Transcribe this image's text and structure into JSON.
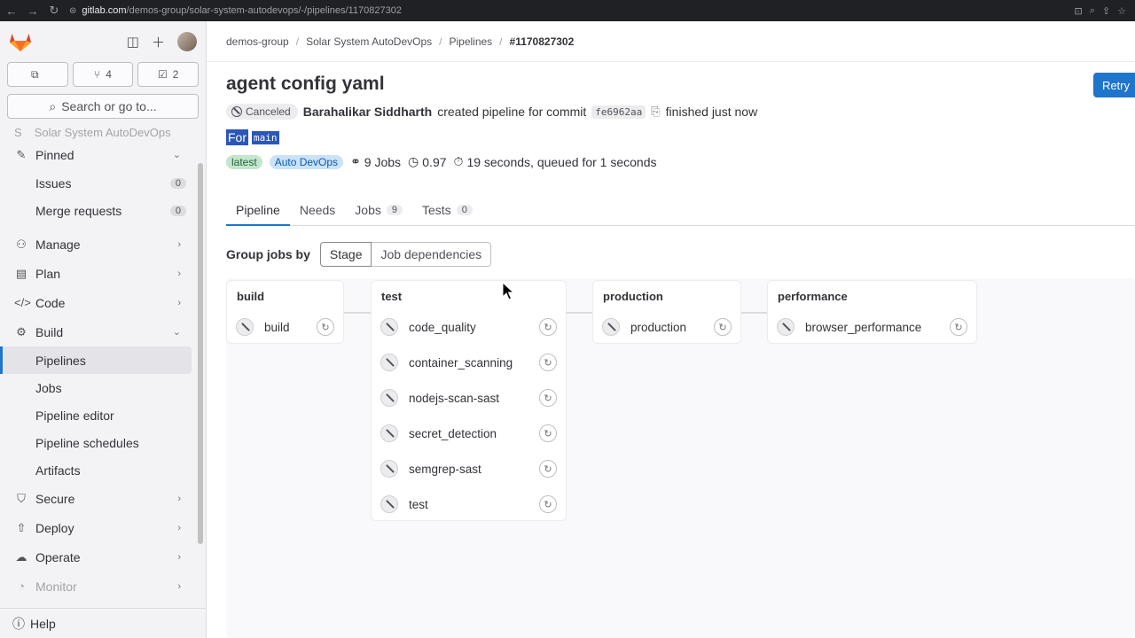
{
  "browser": {
    "url_domain": "gitlab.com",
    "url_path": "/demos-group/solar-system-autodevops/-/pipelines/1170827302"
  },
  "sidebar": {
    "counters": [
      {
        "icon": "issues-icon",
        "count": ""
      },
      {
        "icon": "merge-request-icon",
        "count": "4"
      },
      {
        "icon": "todo-icon",
        "count": "2"
      }
    ],
    "search_label": "Search or go to...",
    "faded_project": "Solar System AutoDevOps",
    "pinned_label": "Pinned",
    "pinned_items": [
      {
        "label": "Issues",
        "badge": "0"
      },
      {
        "label": "Merge requests",
        "badge": "0"
      }
    ],
    "sections": [
      {
        "label": "Manage",
        "icon": "manage-icon"
      },
      {
        "label": "Plan",
        "icon": "plan-icon"
      },
      {
        "label": "Code",
        "icon": "code-icon"
      },
      {
        "label": "Build",
        "icon": "build-icon"
      }
    ],
    "build_items": [
      "Pipelines",
      "Jobs",
      "Pipeline editor",
      "Pipeline schedules",
      "Artifacts"
    ],
    "more_sections": [
      "Secure",
      "Deploy",
      "Operate",
      "Monitor"
    ],
    "help_label": "Help"
  },
  "breadcrumb": [
    "demos-group",
    "Solar System AutoDevOps",
    "Pipelines",
    "#1170827302"
  ],
  "pipeline": {
    "title": "agent config yaml",
    "retry_label": "Retry",
    "status": "Canceled",
    "author": "Barahalikar Siddharth",
    "created_text": "created pipeline for commit",
    "commit_sha": "fe6962aa",
    "finished_text": "finished just now",
    "for_label": "For",
    "branch": "main",
    "tags": [
      "latest",
      "Auto DevOps"
    ],
    "jobs_text": "9 Jobs",
    "score_text": "0.97",
    "duration_text": "19 seconds, queued for 1 seconds"
  },
  "tabs": [
    {
      "label": "Pipeline",
      "count": ""
    },
    {
      "label": "Needs",
      "count": ""
    },
    {
      "label": "Jobs",
      "count": "9"
    },
    {
      "label": "Tests",
      "count": "0"
    }
  ],
  "group_by": {
    "label": "Group jobs by",
    "options": [
      "Stage",
      "Job dependencies"
    ]
  },
  "stages": [
    {
      "name": "build",
      "jobs": [
        "build"
      ]
    },
    {
      "name": "test",
      "jobs": [
        "code_quality",
        "container_scanning",
        "nodejs-scan-sast",
        "secret_detection",
        "semgrep-sast",
        "test"
      ]
    },
    {
      "name": "production",
      "jobs": [
        "production"
      ]
    },
    {
      "name": "performance",
      "jobs": [
        "browser_performance"
      ]
    }
  ],
  "colors": {
    "accent": "#1f75cb",
    "sidebar_bg": "#f3f3f6"
  }
}
